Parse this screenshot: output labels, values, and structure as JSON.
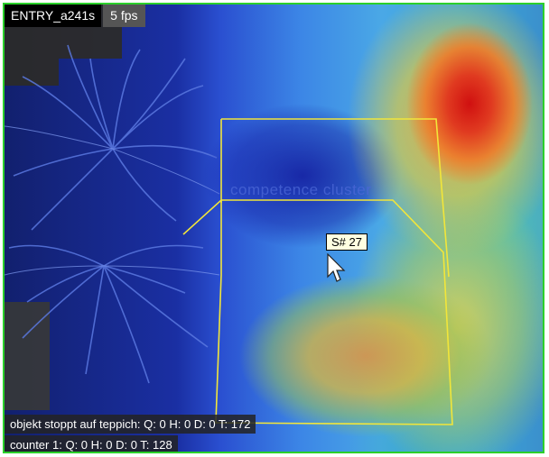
{
  "camera": {
    "name": "ENTRY_a241s",
    "fps": "5 fps"
  },
  "watermark": "competence cluster",
  "tooltip": {
    "label": "S# 27"
  },
  "counters": [
    {
      "label": "objekt stoppt auf teppich:",
      "values": "Q: 0 H: 0 D: 0 T: 172"
    },
    {
      "label": "counter 1:",
      "values": "Q: 0 H: 0 D: 0 T: 128"
    }
  ],
  "colors": {
    "frame_border": "#2bd02b",
    "zone_outline": "#f2e63a",
    "heat_hot": "#d01010",
    "heat_cold": "#1a2fa3"
  },
  "icons": {
    "pointer": "mouse-pointer-icon"
  }
}
